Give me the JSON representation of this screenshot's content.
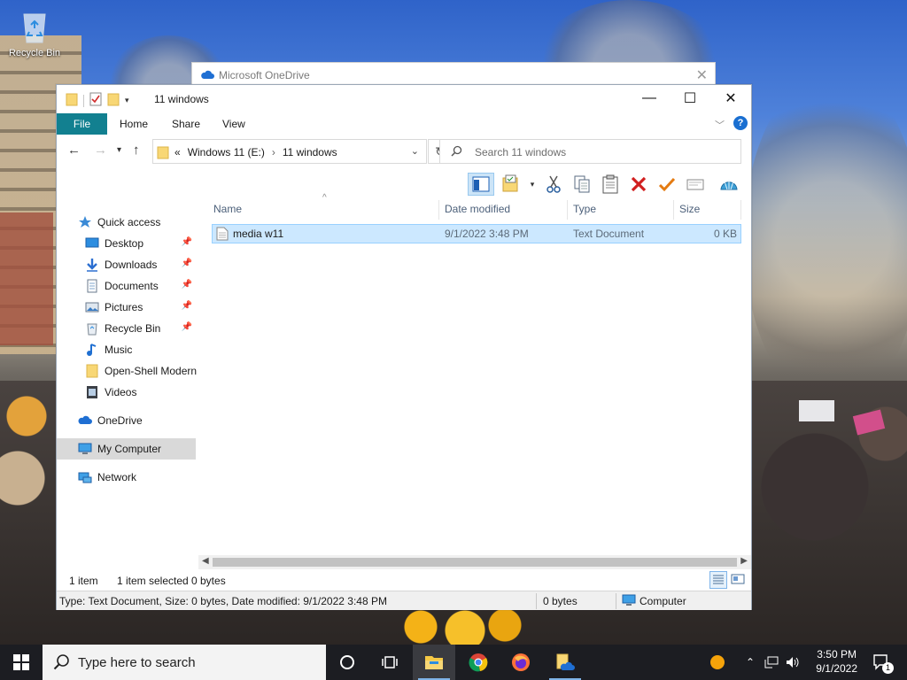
{
  "desktop": {
    "recycle_bin_label": "Recycle Bin"
  },
  "onedrive_dialog": {
    "title": "Microsoft OneDrive"
  },
  "explorer": {
    "window_title": "11 windows",
    "ribbon_tabs": {
      "file": "File",
      "home": "Home",
      "share": "Share",
      "view": "View"
    },
    "help_glyph": "?",
    "address": {
      "overflow": "«",
      "crumbs": [
        "Windows 11 (E:)",
        "11 windows"
      ]
    },
    "search": {
      "placeholder": "Search 11 windows"
    },
    "toolbar_icons": [
      "preview-pane-icon",
      "properties-icon",
      "cut-icon",
      "copy-icon",
      "paste-icon",
      "delete-icon",
      "checkmark-icon",
      "rename-icon",
      "shell-icon"
    ],
    "nav": {
      "quick_access": "Quick access",
      "items": [
        {
          "label": "Desktop",
          "icon": "desktop-icon",
          "pinned": true
        },
        {
          "label": "Downloads",
          "icon": "downloads-icon",
          "pinned": true
        },
        {
          "label": "Documents",
          "icon": "documents-icon",
          "pinned": true
        },
        {
          "label": "Pictures",
          "icon": "pictures-icon",
          "pinned": true
        },
        {
          "label": "Recycle Bin",
          "icon": "recycle-bin-icon",
          "pinned": true
        },
        {
          "label": "Music",
          "icon": "music-icon",
          "pinned": false
        },
        {
          "label": "Open-Shell Modern",
          "icon": "folder-icon",
          "pinned": false
        },
        {
          "label": "Videos",
          "icon": "videos-icon",
          "pinned": false
        }
      ],
      "onedrive": "OneDrive",
      "my_computer": "My Computer",
      "network": "Network"
    },
    "columns": {
      "name": "Name",
      "date_modified": "Date modified",
      "type": "Type",
      "size": "Size"
    },
    "files": [
      {
        "name": "media w11",
        "date_modified": "9/1/2022 3:48 PM",
        "type": "Text Document",
        "size": "0 KB",
        "selected": true
      }
    ],
    "status": {
      "item_count": "1 item",
      "selected": "1 item selected",
      "selected_size": "0 bytes"
    },
    "details_bar": {
      "info": "Type: Text Document, Size: 0 bytes, Date modified: 9/1/2022 3:48 PM",
      "size": "0 bytes",
      "location": "Computer"
    }
  },
  "taskbar": {
    "search_placeholder": "Type here to search",
    "apps": [
      "cortana-icon",
      "task-view-icon",
      "file-explorer-icon",
      "chrome-icon",
      "firefox-icon",
      "onedrive-folder-icon"
    ],
    "clock_time": "3:50 PM",
    "clock_date": "9/1/2022",
    "notification_count": "1"
  },
  "colors": {
    "file_tab": "#128090",
    "selection": "#cce8ff",
    "selection_border": "#99d1ff",
    "taskbar": "#1c1d22",
    "accent_blue": "#1a6fd1"
  }
}
